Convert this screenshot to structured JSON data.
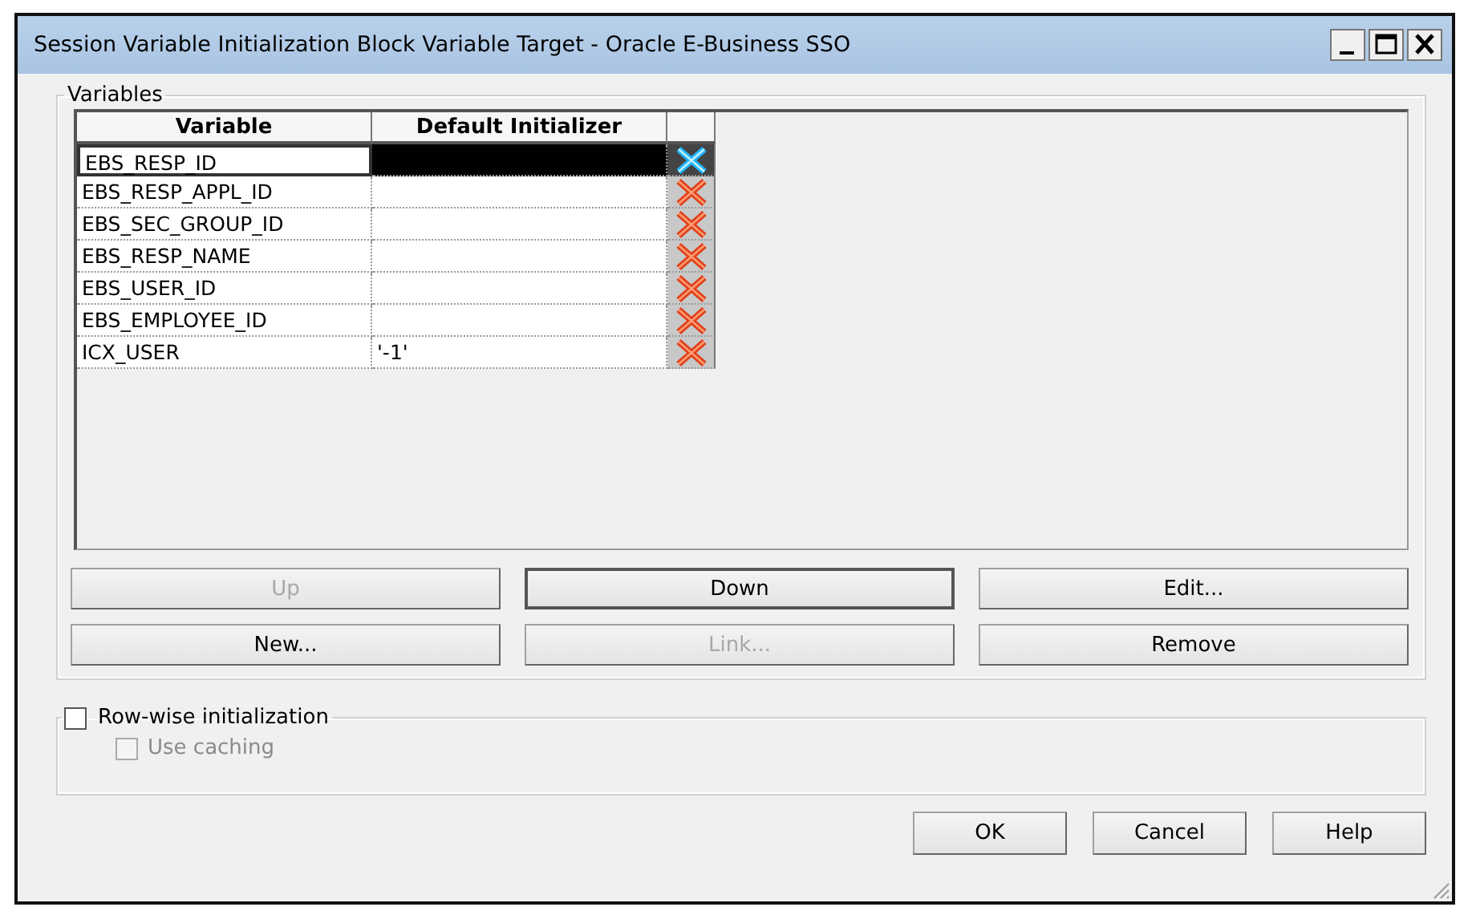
{
  "window": {
    "title": "Session Variable Initialization Block Variable Target - Oracle E-Business SSO"
  },
  "variables": {
    "label": "Variables",
    "columns": [
      "Variable",
      "Default Initializer"
    ],
    "rows": [
      {
        "variable": "EBS_RESP_ID",
        "default": "",
        "selected": true
      },
      {
        "variable": "EBS_RESP_APPL_ID",
        "default": "",
        "selected": false
      },
      {
        "variable": "EBS_SEC_GROUP_ID",
        "default": "",
        "selected": false
      },
      {
        "variable": "EBS_RESP_NAME",
        "default": "",
        "selected": false
      },
      {
        "variable": "EBS_USER_ID",
        "default": "",
        "selected": false
      },
      {
        "variable": "EBS_EMPLOYEE_ID",
        "default": "",
        "selected": false
      },
      {
        "variable": "ICX_USER",
        "default": "'-1'",
        "selected": false
      }
    ],
    "buttons": [
      {
        "label": "Up",
        "disabled": true,
        "default": false
      },
      {
        "label": "Down",
        "disabled": false,
        "default": true
      },
      {
        "label": "Edit...",
        "disabled": false,
        "default": false
      },
      {
        "label": "New...",
        "disabled": false,
        "default": false
      },
      {
        "label": "Link...",
        "disabled": true,
        "default": false
      },
      {
        "label": "Remove",
        "disabled": false,
        "default": false
      }
    ]
  },
  "row_wise": {
    "label": "Row-wise initialization",
    "checked": false,
    "use_caching": {
      "label": "Use caching",
      "checked": false,
      "disabled": true
    }
  },
  "footer_buttons": [
    "OK",
    "Cancel",
    "Help"
  ]
}
